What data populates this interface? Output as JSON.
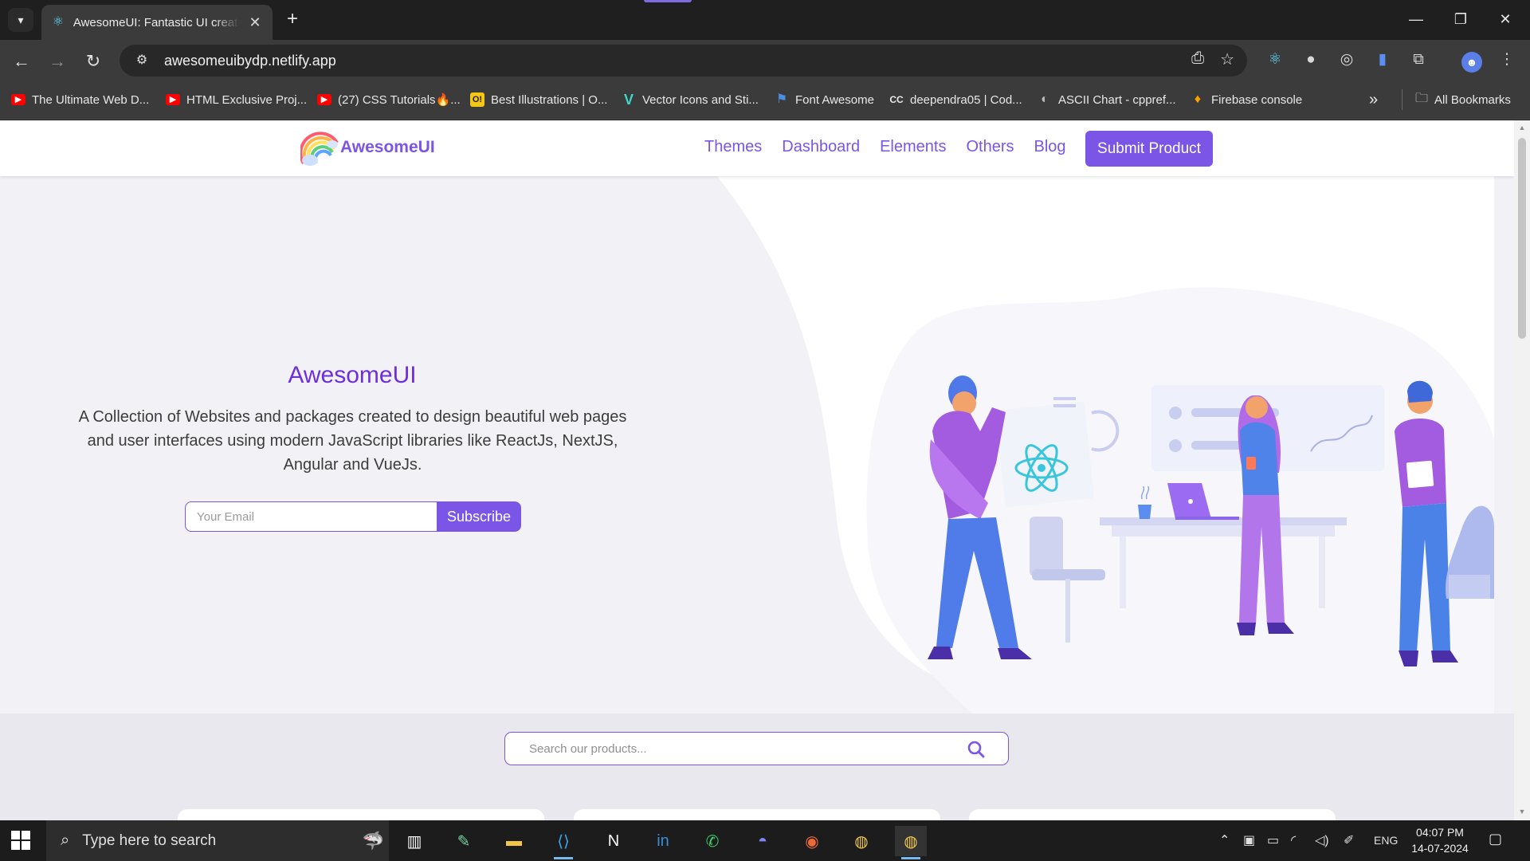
{
  "browser": {
    "tab_title": "AwesomeUI: Fantastic UI creators",
    "url": "awesomeuibydp.netlify.app",
    "bookmarks": [
      {
        "label": "The Ultimate Web D...",
        "icon": "youtube-icon"
      },
      {
        "label": "HTML Exclusive Proj...",
        "icon": "youtube-icon"
      },
      {
        "label": "(27) CSS Tutorials🔥...",
        "icon": "youtube-icon"
      },
      {
        "label": "Best Illustrations | O...",
        "icon": "ouch-icon"
      },
      {
        "label": "Vector Icons and Sti...",
        "icon": "vector-icon"
      },
      {
        "label": "Font Awesome",
        "icon": "flag-icon"
      },
      {
        "label": "deependra05 | Cod...",
        "icon": "codechef-icon"
      },
      {
        "label": "ASCII Chart - cppref...",
        "icon": "cppreference-icon"
      },
      {
        "label": "Firebase console",
        "icon": "firebase-icon"
      }
    ],
    "all_bookmarks": "All Bookmarks",
    "overflow": "»"
  },
  "site": {
    "logo_text": "AwesomeUI",
    "nav": [
      "Themes",
      "Dashboard",
      "Elements",
      "Others",
      "Blog"
    ],
    "submit_label": "Submit Product",
    "hero": {
      "title": "AwesomeUI",
      "description": "A Collection of Websites and packages created to design beautiful web pages and user interfaces using modern JavaScript libraries like ReactJs, NextJS, Angular and VueJs.",
      "email_placeholder": "Your Email",
      "subscribe_label": "Subscribe"
    },
    "search_placeholder": "Search our products..."
  },
  "taskbar": {
    "search_placeholder": "Type here to search",
    "language": "ENG",
    "time": "04:07 PM",
    "date": "14-07-2024"
  },
  "colors": {
    "accent": "#7a55e6",
    "hero_title": "#6d2ee0",
    "hero_bg": "#f2f2f6"
  }
}
